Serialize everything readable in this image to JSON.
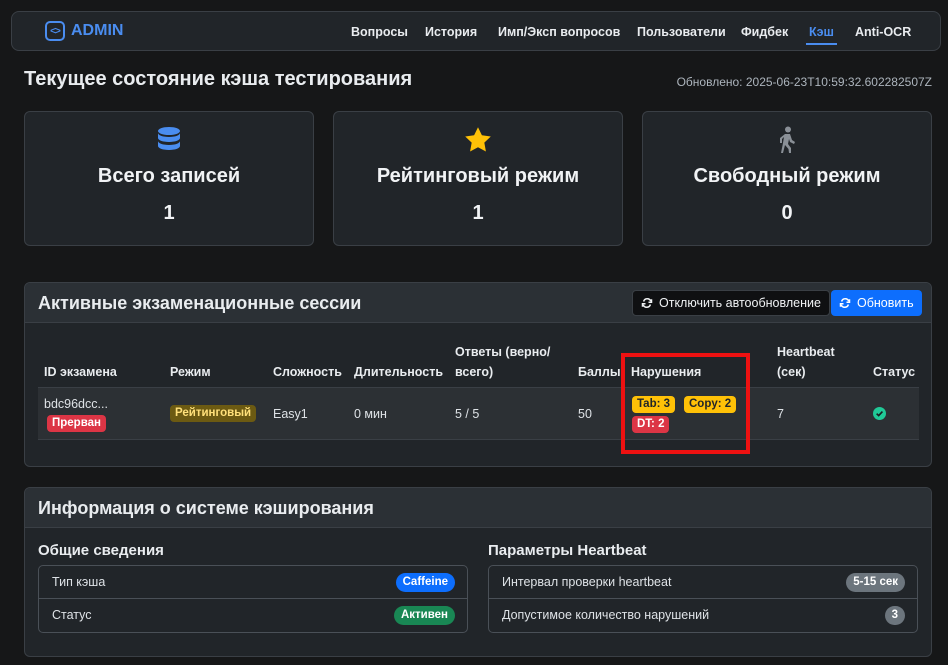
{
  "brand": {
    "name": "ADMIN"
  },
  "nav": [
    {
      "label": "Вопросы"
    },
    {
      "label": "История"
    },
    {
      "label": "Имп/Эксп вопросов"
    },
    {
      "label": "Пользователи"
    },
    {
      "label": "Фидбек"
    },
    {
      "label": "Кэш",
      "active": true
    },
    {
      "label": "Anti-OCR"
    }
  ],
  "header": {
    "title": "Текущее состояние кэша тестирования",
    "updated": "Обновлено: 2025-06-23T10:59:32.602282507Z"
  },
  "stats": [
    {
      "icon": "database-icon",
      "label": "Всего записей",
      "value": "1",
      "color": "#4a8df0"
    },
    {
      "icon": "star-icon",
      "label": "Рейтинговый режим",
      "value": "1",
      "color": "#ffc107"
    },
    {
      "icon": "walking-person-icon",
      "label": "Свободный режим",
      "value": "0",
      "color": "#8a9097"
    }
  ],
  "sessions": {
    "title": "Активные экзаменационные сессии",
    "toggle_label": "Отключить автообновление",
    "refresh_label": "Обновить",
    "columns": [
      "ID экзамена",
      "Режим",
      "Сложность",
      "Длительность",
      "Ответы (верно/ всего)",
      "Баллы",
      "Нарушения",
      "Heartbeat (сек)",
      "Статус"
    ],
    "rows": [
      {
        "id": "bdc96dcc...",
        "status_badge": "Прерван",
        "mode": "Рейтинговый",
        "difficulty": "Easy1",
        "duration": "0 мин",
        "answers": "5 / 5",
        "score": "50",
        "violations": [
          "Tab: 3",
          "Copy: 2",
          "DT: 2"
        ],
        "heartbeat": "7",
        "status_icon": "check-circle-icon"
      }
    ]
  },
  "cache_info": {
    "title": "Информация о системе кэширования",
    "general": {
      "title": "Общие сведения",
      "items": [
        {
          "label": "Тип кэша",
          "badge": "Caffeine",
          "color": "blue"
        },
        {
          "label": "Статус",
          "badge": "Активен",
          "color": "green"
        }
      ]
    },
    "heartbeat": {
      "title": "Параметры Heartbeat",
      "items": [
        {
          "label": "Интервал проверки heartbeat",
          "badge": "5-15 сек",
          "color": "gray"
        },
        {
          "label": "Допустимое количество нарушений",
          "badge": "3",
          "color": "gray"
        }
      ]
    }
  }
}
